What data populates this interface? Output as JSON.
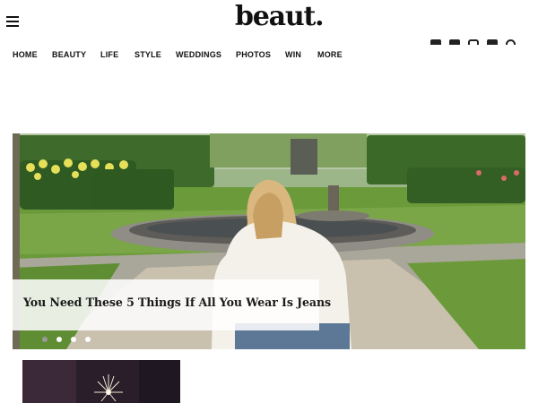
{
  "brand": {
    "logo_text": "beaut."
  },
  "header": {
    "menu_icon": "hamburger-menu-icon",
    "social_icons": [
      "facebook-icon",
      "twitter-icon",
      "instagram-icon",
      "pinterest-icon",
      "search-icon"
    ]
  },
  "nav": {
    "items": [
      {
        "label": "HOME"
      },
      {
        "label": "BEAUTY"
      },
      {
        "label": "LIFE"
      },
      {
        "label": "STYLE"
      },
      {
        "label": "WEDDINGS"
      },
      {
        "label": "PHOTOS"
      },
      {
        "label": "WIN"
      },
      {
        "label": "MORE"
      }
    ]
  },
  "hero": {
    "caption": "You Need These 5 Things If All You Wear Is Jeans",
    "carousel": {
      "total": 4,
      "active_index": 0
    }
  },
  "colors": {
    "text": "#111111",
    "hedge": "#3f6e2c",
    "lawn": "#6b9a3a",
    "path": "#c8c0b0",
    "shirt": "#f4f1ea",
    "hair": "#d9b77e",
    "thumb_bg": "#2a1e2a"
  }
}
